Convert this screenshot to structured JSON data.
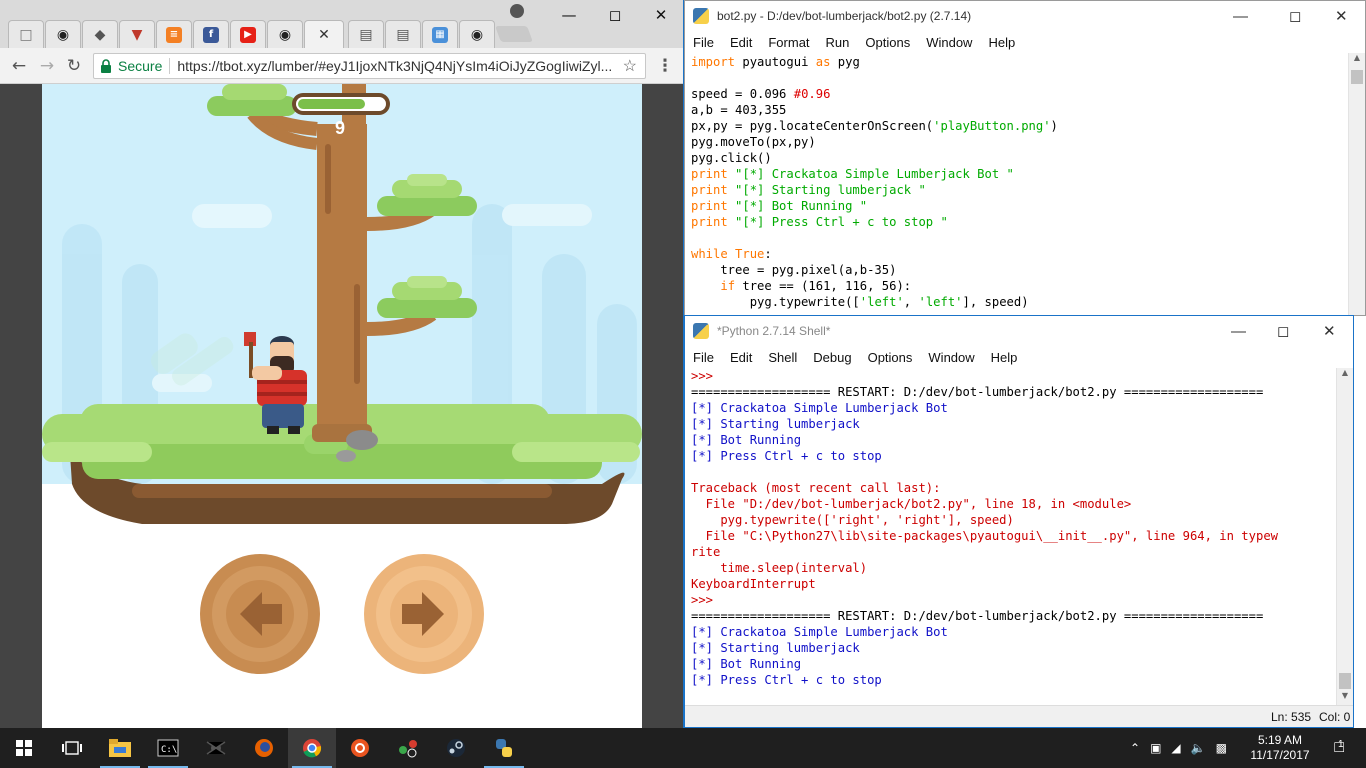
{
  "browser": {
    "tabs": [
      {
        "icon": "document-icon",
        "color": "#777777"
      },
      {
        "icon": "github-icon",
        "color": "#222222"
      },
      {
        "icon": "diamond-icon",
        "color": "#555555"
      },
      {
        "icon": "bird-icon",
        "color": "#c0392b"
      },
      {
        "icon": "stackoverflow-icon",
        "color": "#f48024"
      },
      {
        "icon": "facebook-icon",
        "color": "#3b5998"
      },
      {
        "icon": "youtube-icon",
        "color": "#e62117"
      },
      {
        "icon": "github-icon",
        "color": "#222222"
      },
      {
        "icon": "close-icon",
        "color": "#333333",
        "active": true
      },
      {
        "icon": "book-icon",
        "color": "#555555"
      },
      {
        "icon": "book-icon",
        "color": "#555555"
      },
      {
        "icon": "image-icon",
        "color": "#4a90d9"
      },
      {
        "icon": "github-icon",
        "color": "#222222"
      }
    ],
    "secure_label": "Secure",
    "url": "https://tbot.xyz/lumber/#eyJ1IjoxNTk3NjQ4NjYsIm4iOiJyZGogIiwiZyl..."
  },
  "game": {
    "score": "9",
    "timer_fill": 0.78,
    "colors": {
      "sky": "#cfeffb",
      "trunk": "#b57a43",
      "leaf": "#8ccb5e",
      "ground": "#a6da74"
    }
  },
  "editor": {
    "title": "bot2.py - D:/dev/bot-lumberjack/bot2.py (2.7.14)",
    "menu": [
      "File",
      "Edit",
      "Format",
      "Run",
      "Options",
      "Window",
      "Help"
    ],
    "lines": [
      [
        [
          "kw",
          "import"
        ],
        [
          "blk",
          " pyautogui "
        ],
        [
          "kw",
          "as"
        ],
        [
          "blk",
          " pyg"
        ]
      ],
      [],
      [
        [
          "blk",
          "speed = 0.096 "
        ],
        [
          "cm",
          "#0.96"
        ]
      ],
      [
        [
          "blk",
          "a,b = 403,355"
        ]
      ],
      [
        [
          "blk",
          "px,py = pyg.locateCenterOnScreen("
        ],
        [
          "st",
          "'playButton.png'"
        ],
        [
          "blk",
          ")"
        ]
      ],
      [
        [
          "blk",
          "pyg.moveTo(px,py)"
        ]
      ],
      [
        [
          "blk",
          "pyg.click()"
        ]
      ],
      [
        [
          "kw",
          "print"
        ],
        [
          "blk",
          " "
        ],
        [
          "st",
          "\"[*] Crackatoa Simple Lumberjack Bot \""
        ]
      ],
      [
        [
          "kw",
          "print"
        ],
        [
          "blk",
          " "
        ],
        [
          "st",
          "\"[*] Starting lumberjack \""
        ]
      ],
      [
        [
          "kw",
          "print"
        ],
        [
          "blk",
          " "
        ],
        [
          "st",
          "\"[*] Bot Running \""
        ]
      ],
      [
        [
          "kw",
          "print"
        ],
        [
          "blk",
          " "
        ],
        [
          "st",
          "\"[*] Press Ctrl + c to stop \""
        ]
      ],
      [],
      [
        [
          "kw",
          "while"
        ],
        [
          "blk",
          " "
        ],
        [
          "kw",
          "True"
        ],
        [
          "blk",
          ":"
        ]
      ],
      [
        [
          "blk",
          "    tree = pyg.pixel(a,b-35)"
        ]
      ],
      [
        [
          "blk",
          "    "
        ],
        [
          "kw",
          "if"
        ],
        [
          "blk",
          " tree == (161, 116, 56):"
        ]
      ],
      [
        [
          "blk",
          "        pyg.typewrite(["
        ],
        [
          "st",
          "'left'"
        ],
        [
          "blk",
          ", "
        ],
        [
          "st",
          "'left'"
        ],
        [
          "blk",
          "], speed)"
        ]
      ]
    ]
  },
  "shell": {
    "title": "*Python 2.7.14 Shell*",
    "menu": [
      "File",
      "Edit",
      "Shell",
      "Debug",
      "Options",
      "Window",
      "Help"
    ],
    "lines": [
      [
        [
          "rd",
          ">>>"
        ]
      ],
      [
        [
          "blk",
          "=================== RESTART: D:/dev/bot-lumberjack/bot2.py ==================="
        ]
      ],
      [
        [
          "bl",
          "[*] Crackatoa Simple Lumberjack Bot"
        ]
      ],
      [
        [
          "bl",
          "[*] Starting lumberjack"
        ]
      ],
      [
        [
          "bl",
          "[*] Bot Running"
        ]
      ],
      [
        [
          "bl",
          "[*] Press Ctrl + c to stop"
        ]
      ],
      [],
      [
        [
          "rd",
          "Traceback (most recent call last):"
        ]
      ],
      [
        [
          "rd",
          "  File \"D:/dev/bot-lumberjack/bot2.py\", line 18, in <module>"
        ]
      ],
      [
        [
          "rd",
          "    pyg.typewrite(['right', 'right'], speed)"
        ]
      ],
      [
        [
          "rd",
          "  File \"C:\\Python27\\lib\\site-packages\\pyautogui\\__init__.py\", line 964, in typew"
        ]
      ],
      [
        [
          "rd",
          "rite"
        ]
      ],
      [
        [
          "rd",
          "    time.sleep(interval)"
        ]
      ],
      [
        [
          "rd",
          "KeyboardInterrupt"
        ]
      ],
      [
        [
          "rd",
          ">>>"
        ]
      ],
      [
        [
          "blk",
          "=================== RESTART: D:/dev/bot-lumberjack/bot2.py ==================="
        ]
      ],
      [
        [
          "bl",
          "[*] Crackatoa Simple Lumberjack Bot"
        ]
      ],
      [
        [
          "bl",
          "[*] Starting lumberjack"
        ]
      ],
      [
        [
          "bl",
          "[*] Bot Running"
        ]
      ],
      [
        [
          "bl",
          "[*] Press Ctrl + c to stop"
        ]
      ]
    ],
    "status_ln": "Ln: 535",
    "status_col": "Col: 0"
  },
  "taskbar": {
    "apps": [
      "cmd-icon",
      "spider-icon",
      "firefox-icon",
      "chrome-icon",
      "ubuntu-icon",
      "share-icon",
      "steam-icon",
      "python-icon"
    ],
    "time": "5:19 AM",
    "date": "11/17/2017",
    "notification_count": "1"
  }
}
